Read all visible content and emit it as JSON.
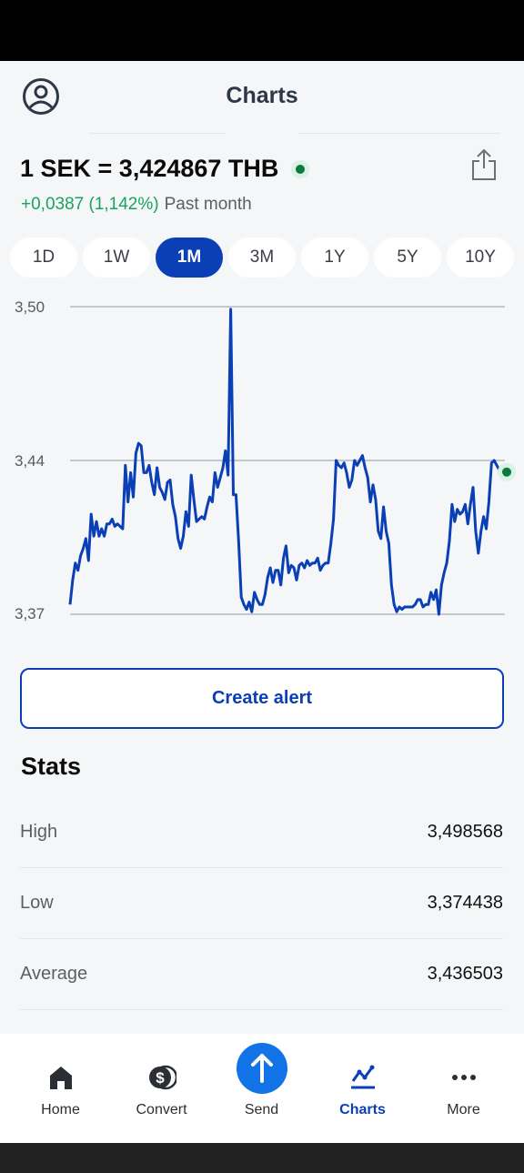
{
  "header": {
    "title": "Charts"
  },
  "rate": {
    "text": "1 SEK = 3,424867 THB",
    "change": "+0,0387 (1,142%)",
    "period": "Past month"
  },
  "ranges": [
    "1D",
    "1W",
    "1M",
    "3M",
    "1Y",
    "5Y",
    "10Y"
  ],
  "selected_range": "1M",
  "chart_data": {
    "type": "line",
    "title": "",
    "xlabel": "",
    "ylabel": "",
    "y_ticks": [
      "3,50",
      "3,44",
      "3,37"
    ],
    "ylim": [
      3.374,
      3.5
    ],
    "color": "#0b3fb5",
    "grid": true,
    "series": [
      {
        "values": [
          3.378,
          3.388,
          3.395,
          3.392,
          3.398,
          3.401,
          3.405,
          3.396,
          3.415,
          3.406,
          3.412,
          3.406,
          3.409,
          3.406,
          3.411,
          3.411,
          3.413,
          3.41,
          3.411,
          3.41,
          3.409,
          3.435,
          3.42,
          3.432,
          3.422,
          3.44,
          3.444,
          3.443,
          3.432,
          3.432,
          3.435,
          3.428,
          3.423,
          3.434,
          3.426,
          3.424,
          3.421,
          3.428,
          3.429,
          3.419,
          3.414,
          3.405,
          3.401,
          3.406,
          3.416,
          3.41,
          3.431,
          3.421,
          3.412,
          3.413,
          3.414,
          3.413,
          3.418,
          3.422,
          3.42,
          3.432,
          3.426,
          3.43,
          3.434,
          3.441,
          3.431,
          3.499,
          3.423,
          3.423,
          3.404,
          3.381,
          3.378,
          3.376,
          3.379,
          3.375,
          3.383,
          3.38,
          3.378,
          3.378,
          3.382,
          3.389,
          3.393,
          3.387,
          3.392,
          3.392,
          3.386,
          3.397,
          3.402,
          3.391,
          3.394,
          3.393,
          3.388,
          3.394,
          3.395,
          3.393,
          3.396,
          3.394,
          3.395,
          3.395,
          3.397,
          3.392,
          3.394,
          3.395,
          3.395,
          3.403,
          3.413,
          3.437,
          3.435,
          3.434,
          3.436,
          3.432,
          3.426,
          3.429,
          3.437,
          3.435,
          3.437,
          3.439,
          3.434,
          3.43,
          3.42,
          3.427,
          3.421,
          3.408,
          3.405,
          3.418,
          3.408,
          3.403,
          3.386,
          3.378,
          3.375,
          3.377,
          3.376,
          3.377,
          3.377,
          3.377,
          3.377,
          3.378,
          3.38,
          3.38,
          3.377,
          3.378,
          3.378,
          3.383,
          3.38,
          3.384,
          3.374,
          3.386,
          3.391,
          3.395,
          3.404,
          3.419,
          3.412,
          3.417,
          3.415,
          3.416,
          3.419,
          3.411,
          3.419,
          3.426,
          3.408,
          3.399,
          3.408,
          3.414,
          3.409,
          3.42,
          3.436,
          3.437,
          3.435,
          3.433
        ]
      }
    ]
  },
  "create_alert_label": "Create alert",
  "stats": {
    "title": "Stats",
    "rows": [
      {
        "label": "High",
        "value": "3,498568"
      },
      {
        "label": "Low",
        "value": "3,374438"
      },
      {
        "label": "Average",
        "value": "3,436503"
      }
    ]
  },
  "nav": {
    "items": [
      {
        "label": "Home",
        "icon": "home-icon"
      },
      {
        "label": "Convert",
        "icon": "dollar-coins-icon"
      },
      {
        "label": "Send",
        "icon": "arrow-up-icon"
      },
      {
        "label": "Charts",
        "icon": "chart-line-icon",
        "active": true
      },
      {
        "label": "More",
        "icon": "more-dots-icon"
      }
    ]
  },
  "colors": {
    "brand": "#0b3fb5",
    "positive": "#1aa35c",
    "send": "#1273e6"
  }
}
